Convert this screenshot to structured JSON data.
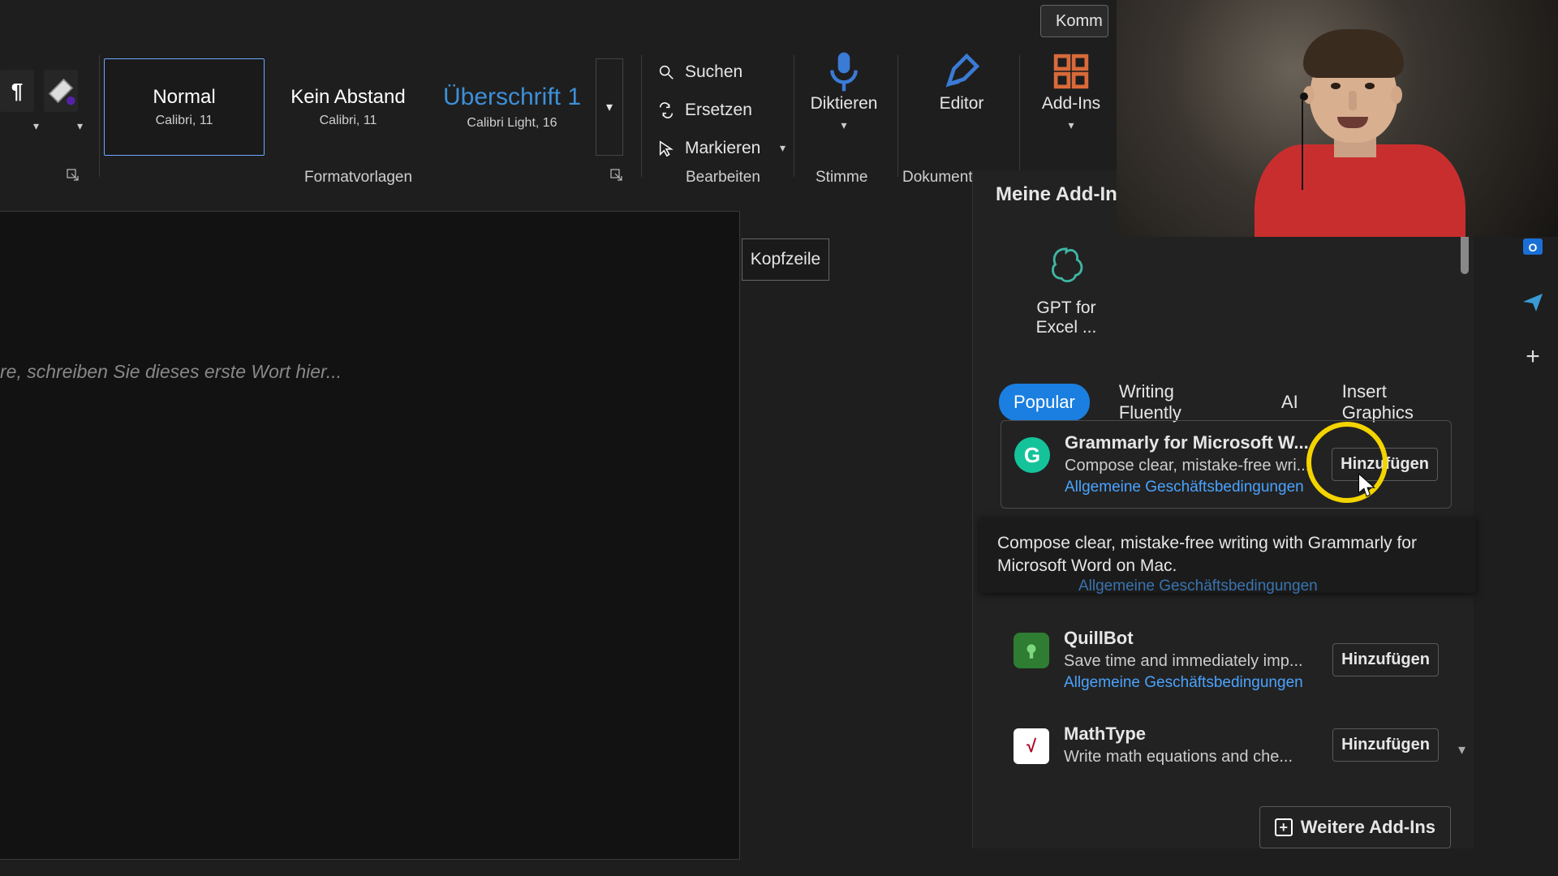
{
  "top": {
    "comments_label": "Komm"
  },
  "ribbon": {
    "styles": [
      {
        "title": "Normal",
        "sub": "Calibri, 11"
      },
      {
        "title": "Kein Abstand",
        "sub": "Calibri, 11"
      },
      {
        "title": "Überschrift 1",
        "sub": "Calibri Light, 16"
      }
    ],
    "groups": {
      "styles_label": "Formatvorlagen",
      "edit_label": "Bearbeiten",
      "voice_label": "Stimme",
      "docreview_label": "Dokumentp"
    },
    "edit": {
      "find": "Suchen",
      "replace": "Ersetzen",
      "select": "Markieren"
    },
    "dictate": "Diktieren",
    "editor": "Editor",
    "addins": "Add-Ins"
  },
  "document": {
    "placeholder": "re, schreiben Sie dieses erste Wort hier...",
    "header_button": "Kopfzeile"
  },
  "panel": {
    "title": "Meine Add-Ins",
    "my_addin": {
      "name": "GPT for Excel ..."
    },
    "tabs": [
      "Popular",
      "Writing Fluently",
      "AI",
      "Insert Graphics"
    ],
    "active_tab": 0,
    "cards": [
      {
        "title": "Grammarly for Microsoft W...",
        "desc": "Compose clear, mistake-free wri...",
        "terms": "Allgemeine Geschäftsbedingungen",
        "add_label": "Hinzufügen",
        "tooltip": "Compose clear, mistake-free writing with Grammarly for Microsoft Word on Mac."
      },
      {
        "title": "QuillBot",
        "desc": "Save time and immediately imp...",
        "terms": "Allgemeine Geschäftsbedingungen",
        "add_label": "Hinzufügen"
      },
      {
        "title": "MathType",
        "desc": "Write math equations and che...",
        "add_label": "Hinzufügen"
      }
    ],
    "more_label": "Weitere Add-Ins"
  },
  "rail_plus": "+"
}
